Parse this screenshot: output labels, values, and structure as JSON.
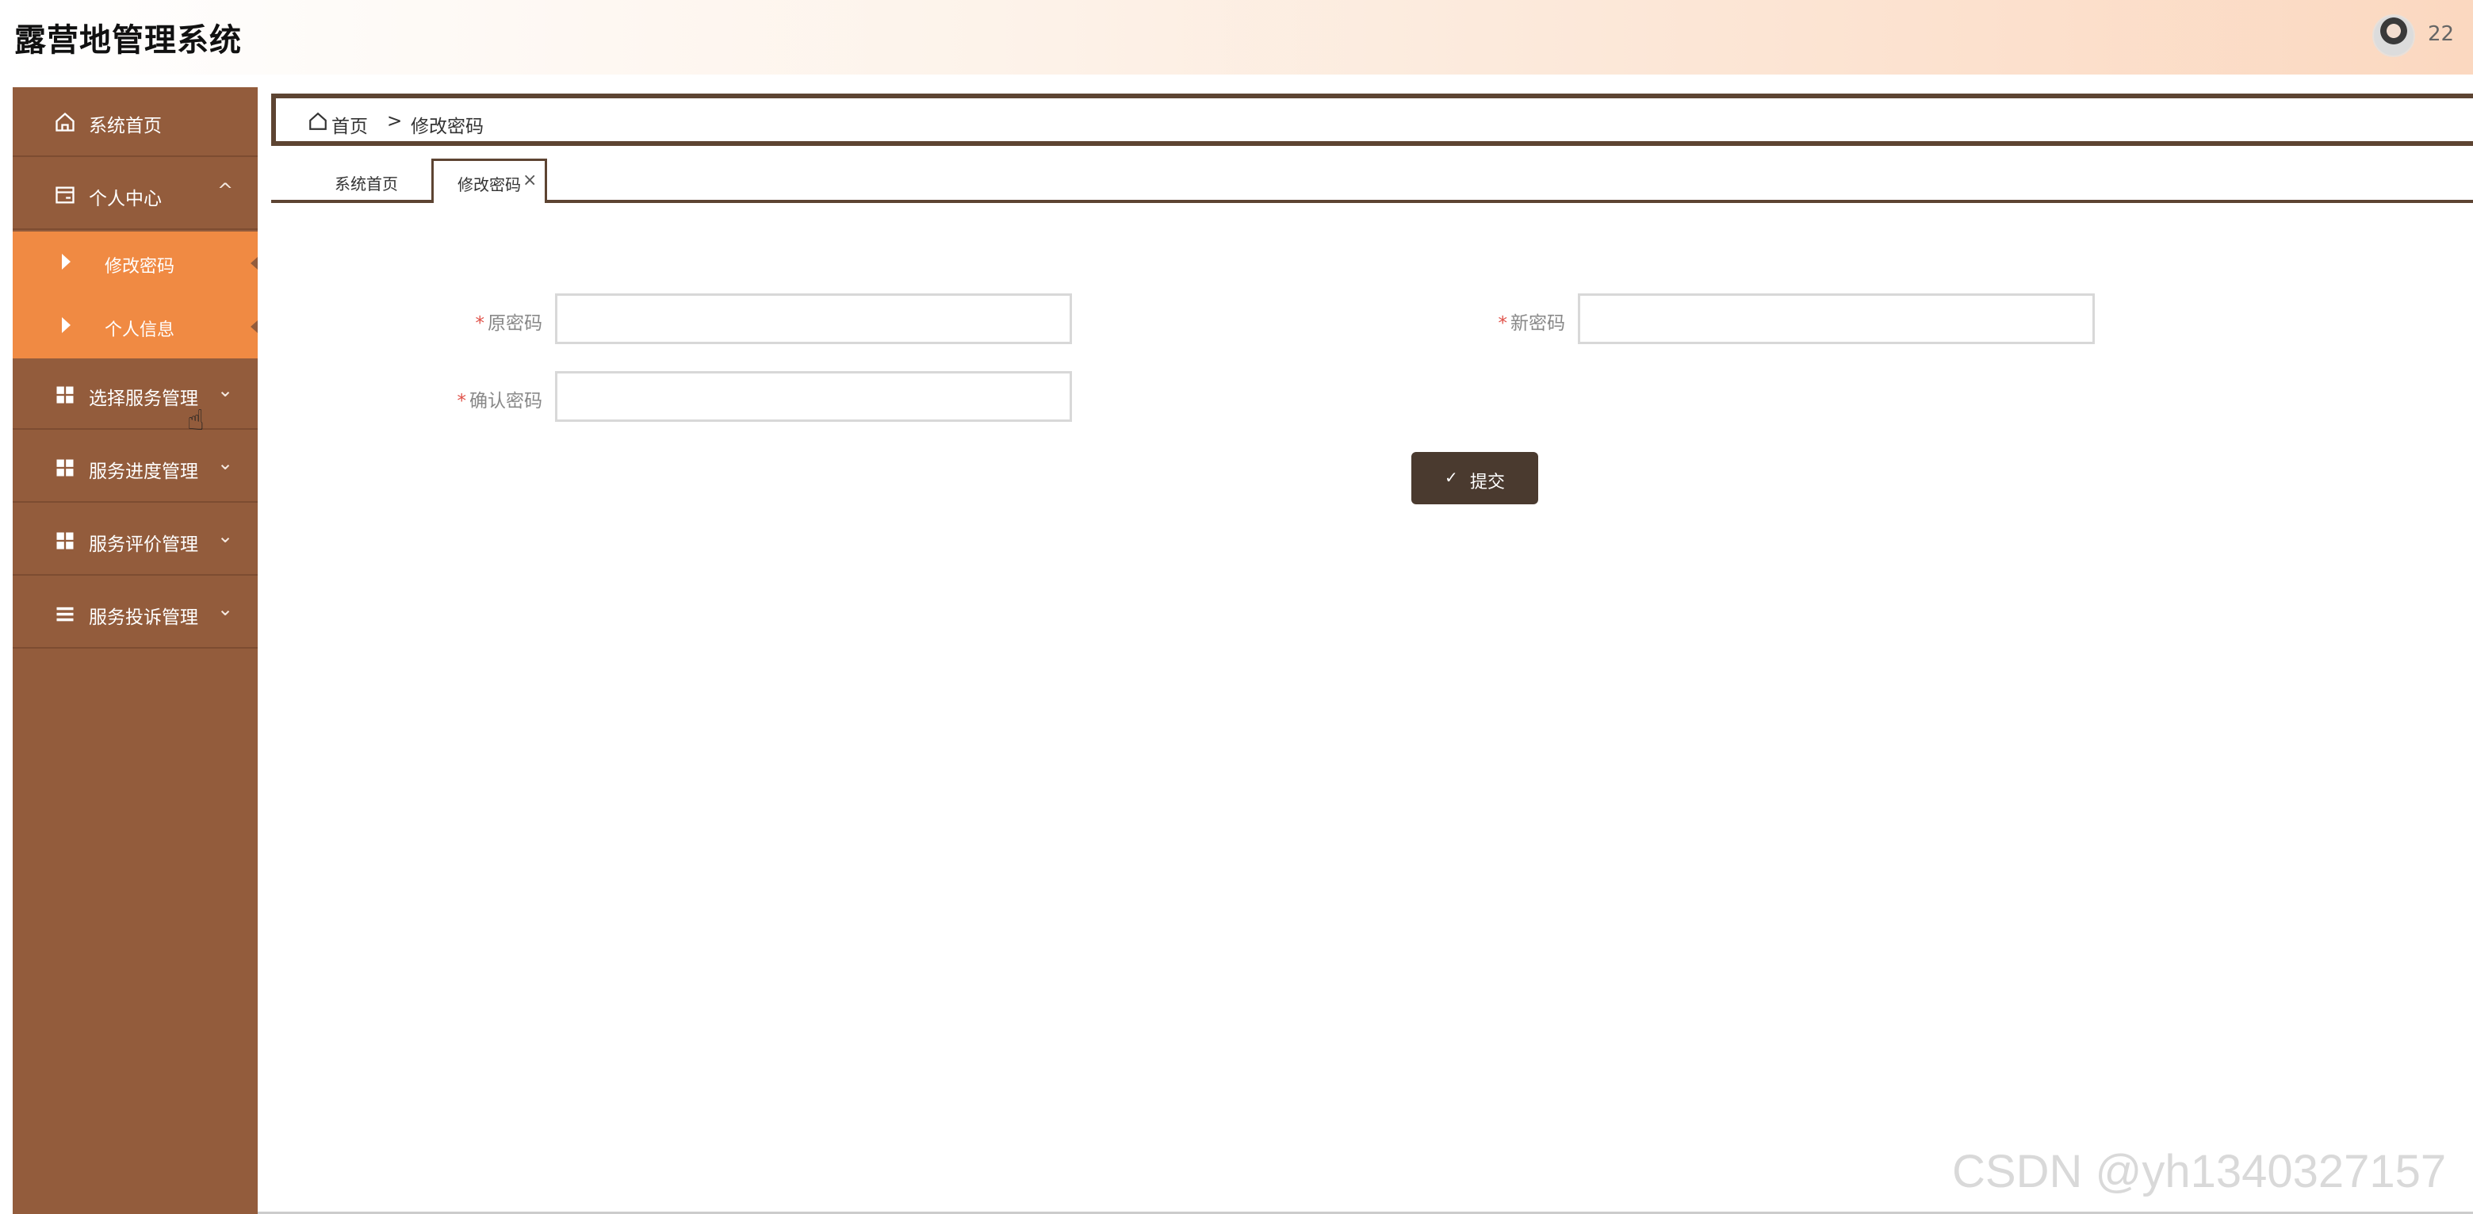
{
  "header": {
    "app_title": "露营地管理系统",
    "user_name": "22"
  },
  "sidebar": {
    "items": [
      {
        "label": "系统首页",
        "icon": "home-icon"
      },
      {
        "label": "个人中心",
        "icon": "card-icon",
        "expanded": true,
        "children": [
          {
            "label": "修改密码"
          },
          {
            "label": "个人信息"
          }
        ]
      },
      {
        "label": "选择服务管理",
        "icon": "grid-icon"
      },
      {
        "label": "服务进度管理",
        "icon": "grid-icon"
      },
      {
        "label": "服务评价管理",
        "icon": "grid-icon"
      },
      {
        "label": "服务投诉管理",
        "icon": "list-icon"
      }
    ]
  },
  "breadcrumb": {
    "home": "首页",
    "separator": ">",
    "current": "修改密码"
  },
  "tabs": [
    {
      "label": "系统首页",
      "active": false
    },
    {
      "label": "修改密码",
      "active": true,
      "close": "×"
    }
  ],
  "form": {
    "required_mark": "*",
    "old_password": {
      "label": "原密码",
      "value": ""
    },
    "new_password": {
      "label": "新密码",
      "value": ""
    },
    "confirm_password": {
      "label": "确认密码",
      "value": ""
    },
    "submit_label": "提交"
  },
  "watermark": "CSDN @yh1340327157",
  "colors": {
    "sidebar_bg": "#935c3c",
    "sidebar_active": "#f08a43",
    "accent_dark": "#5d4432",
    "button_bg": "#4a3a2f"
  }
}
